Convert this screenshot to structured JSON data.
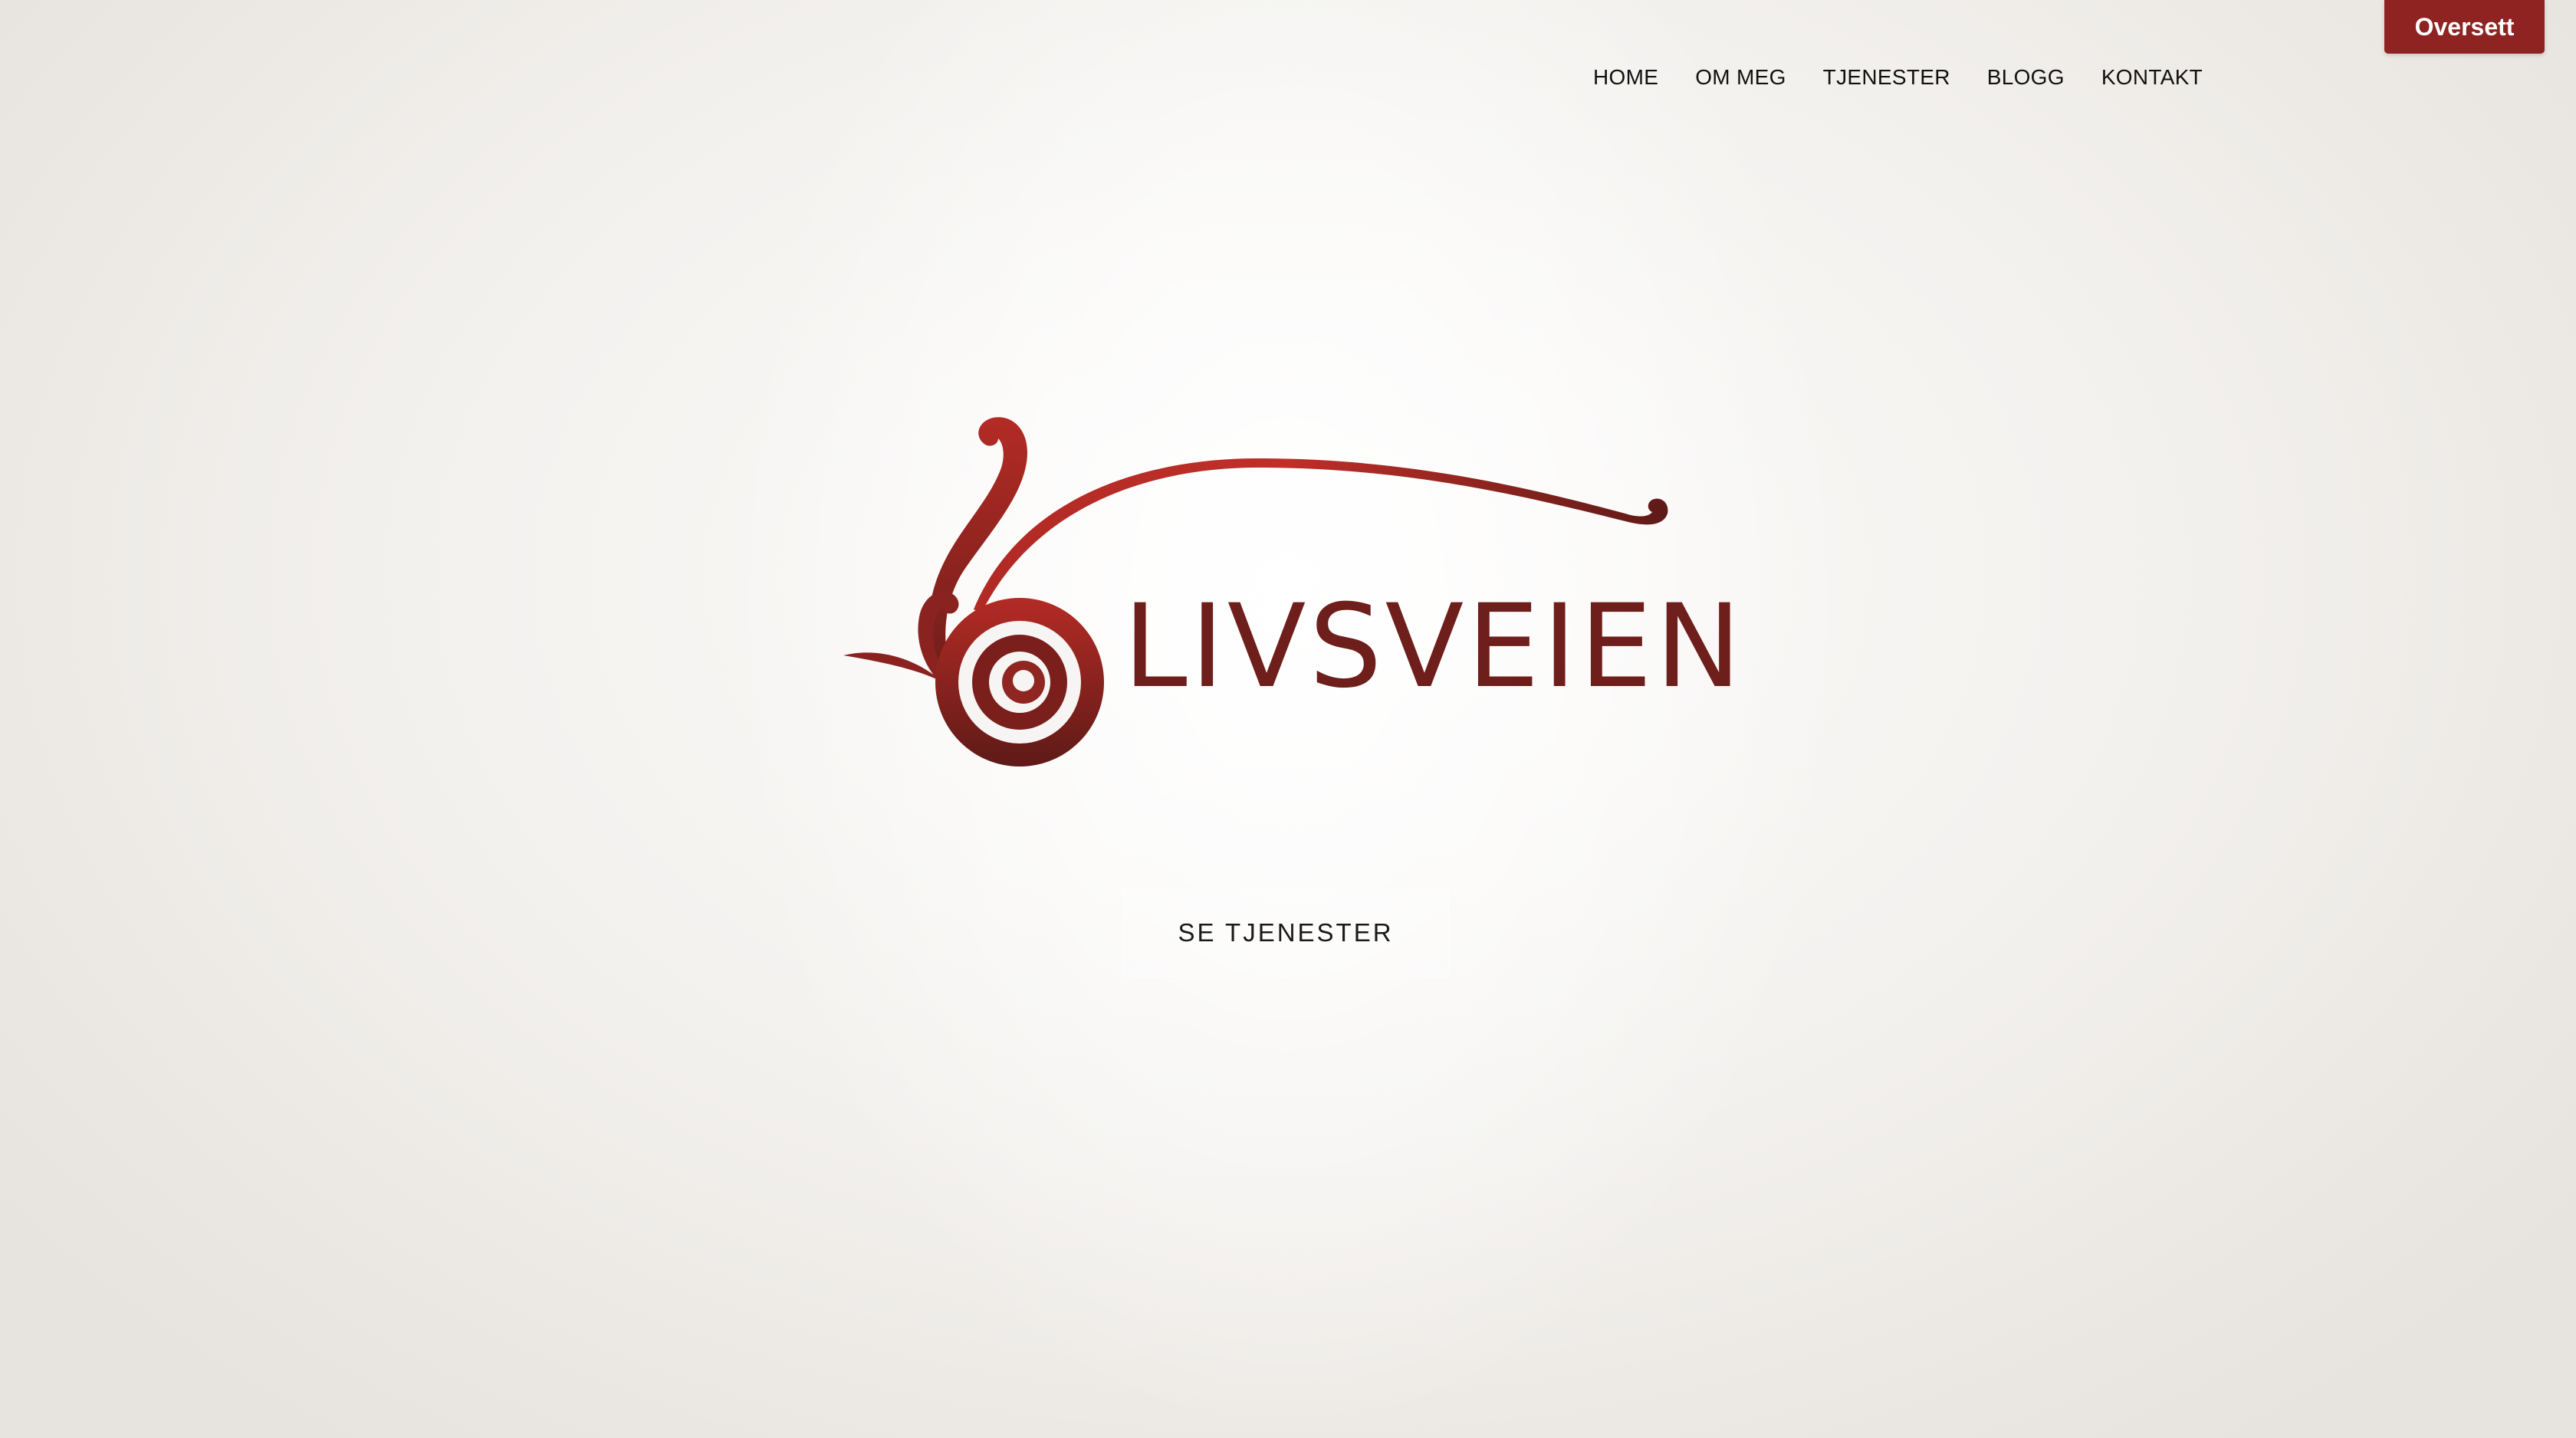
{
  "nav": {
    "items": [
      {
        "label": "HOME"
      },
      {
        "label": "OM MEG"
      },
      {
        "label": "TJENESTER"
      },
      {
        "label": "BLOGG"
      },
      {
        "label": "KONTAKT"
      }
    ]
  },
  "translate": {
    "label": "Oversett"
  },
  "logo": {
    "text": "LIVSVEIEN",
    "colors": {
      "light": "#c0302a",
      "dark": "#6a1c19"
    }
  },
  "hero": {
    "cta_label": "SE TJENESTER"
  },
  "colors": {
    "accent": "#8e2322",
    "text": "#111111"
  }
}
